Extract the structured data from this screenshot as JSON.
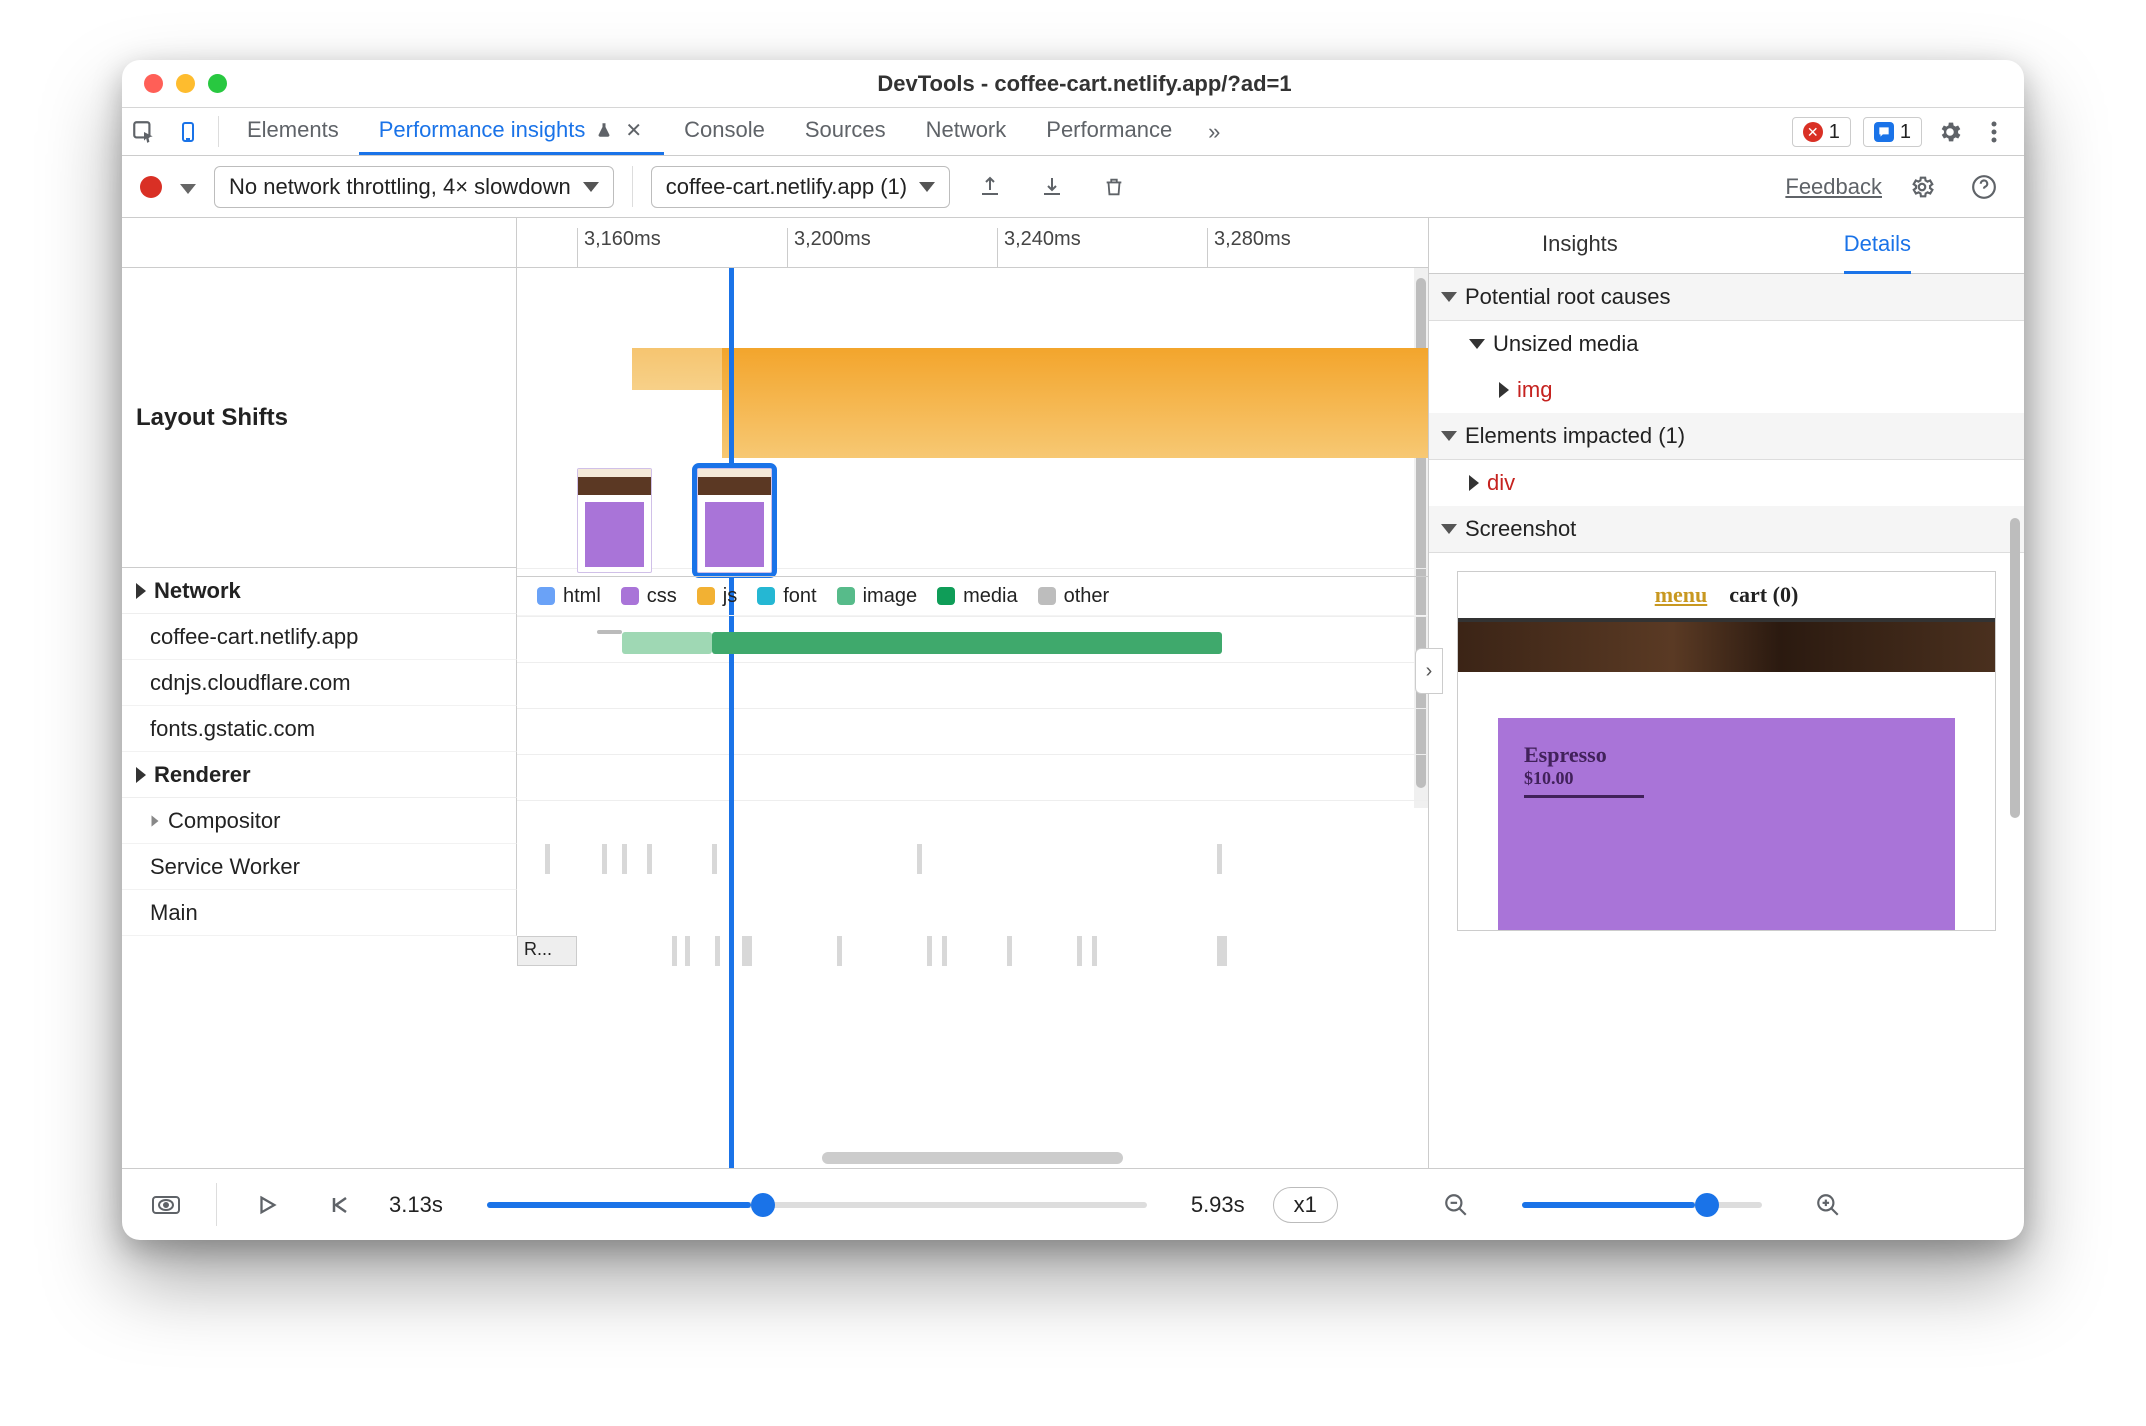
{
  "window": {
    "title": "DevTools - coffee-cart.netlify.app/?ad=1"
  },
  "tabs": {
    "list": [
      "Elements",
      "Performance insights",
      "Console",
      "Sources",
      "Network",
      "Performance"
    ],
    "active_index": 1
  },
  "badges": {
    "error_count": "1",
    "message_count": "1"
  },
  "toolbar": {
    "throttle": "No network throttling, 4× slowdown",
    "session": "coffee-cart.netlify.app (1)",
    "feedback": "Feedback"
  },
  "ruler_ticks": [
    "3,160ms",
    "3,200ms",
    "3,240ms",
    "3,280ms"
  ],
  "tracks": {
    "layout_shifts": "Layout Shifts",
    "network": {
      "label": "Network",
      "hosts": [
        "coffee-cart.netlify.app",
        "cdnjs.cloudflare.com",
        "fonts.gstatic.com"
      ]
    },
    "renderer": {
      "label": "Renderer",
      "subs": [
        "Compositor",
        "Service Worker",
        "Main"
      ],
      "main_task_label": "R..."
    },
    "legend": [
      {
        "label": "html",
        "color": "#6aa2f7"
      },
      {
        "label": "css",
        "color": "#a974d8"
      },
      {
        "label": "js",
        "color": "#f2b133"
      },
      {
        "label": "font",
        "color": "#25b7d3"
      },
      {
        "label": "image",
        "color": "#57bb8a"
      },
      {
        "label": "media",
        "color": "#0f9d58"
      },
      {
        "label": "other",
        "color": "#bdbdbd"
      }
    ]
  },
  "details": {
    "tab_insights": "Insights",
    "tab_details": "Details",
    "root_causes": "Potential root causes",
    "unsized_media": "Unsized media",
    "img_tag": "img",
    "impacted": "Elements impacted (1)",
    "div_tag": "div",
    "screenshot": "Screenshot",
    "ss_menu": "menu",
    "ss_cart": "cart (0)",
    "ss_item": "Espresso",
    "ss_price": "$10.00"
  },
  "footer": {
    "start": "3.13s",
    "end": "5.93s",
    "speed": "x1"
  }
}
